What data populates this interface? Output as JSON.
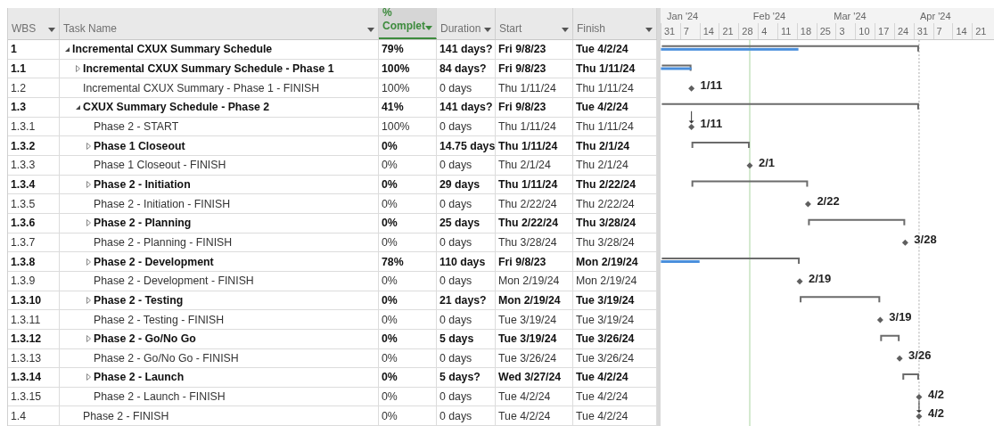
{
  "columns": [
    {
      "label": "WBS",
      "selected": false
    },
    {
      "label": "Task Name",
      "selected": false
    },
    {
      "label": "% Complet",
      "selected": true
    },
    {
      "label": "Duration",
      "selected": false
    },
    {
      "label": "Start",
      "selected": false
    },
    {
      "label": "Finish",
      "selected": false
    }
  ],
  "timescale": {
    "months": [
      "Jan '24",
      "Feb '24",
      "Mar '24",
      "Apr '24"
    ],
    "days": [
      "31",
      "7",
      "14",
      "21",
      "28",
      "4",
      "11",
      "18",
      "25",
      "3",
      "10",
      "17",
      "24",
      "31",
      "7",
      "14",
      "21"
    ]
  },
  "rows": [
    {
      "wbs": "1",
      "name": "Incremental CXUX Summary Schedule",
      "pct": "79%",
      "duration": "141 days?",
      "start": "Fri 9/8/23",
      "finish": "Tue 4/2/24",
      "kind": "summary",
      "expanded": true,
      "children": [
        {
          "wbs": "1.1",
          "name": "Incremental CXUX Summary Schedule - Phase 1",
          "pct": "100%",
          "duration": "84 days?",
          "start": "Fri 9/8/23",
          "finish": "Thu 1/11/24",
          "kind": "summary",
          "expanded": false
        },
        {
          "wbs": "1.2",
          "name": "Incremental CXUX Summary - Phase 1 - FINISH",
          "pct": "100%",
          "duration": "0 days",
          "start": "Thu 1/11/24",
          "finish": "Thu 1/11/24",
          "kind": "milestone",
          "gantt_label": "1/11",
          "linked": false
        },
        {
          "wbs": "1.3",
          "name": "CXUX Summary Schedule - Phase 2",
          "pct": "41%",
          "duration": "141 days?",
          "start": "Fri 9/8/23",
          "finish": "Tue 4/2/24",
          "kind": "summary",
          "expanded": true,
          "children": [
            {
              "wbs": "1.3.1",
              "name": "Phase 2 - START",
              "pct": "100%",
              "duration": "0 days",
              "start": "Thu 1/11/24",
              "finish": "Thu 1/11/24",
              "kind": "milestone",
              "gantt_label": "1/11",
              "linked": true
            },
            {
              "wbs": "1.3.2",
              "name": "Phase 1 Closeout",
              "pct": "0%",
              "duration": "14.75 days",
              "start": "Thu 1/11/24",
              "finish": "Thu 2/1/24",
              "kind": "summary",
              "expanded": false
            },
            {
              "wbs": "1.3.3",
              "name": "Phase 1 Closeout - FINISH",
              "pct": "0%",
              "duration": "0 days",
              "start": "Thu 2/1/24",
              "finish": "Thu 2/1/24",
              "kind": "milestone",
              "gantt_label": "2/1",
              "linked": false
            },
            {
              "wbs": "1.3.4",
              "name": "Phase 2 - Initiation",
              "pct": "0%",
              "duration": "29 days",
              "start": "Thu 1/11/24",
              "finish": "Thu 2/22/24",
              "kind": "summary",
              "expanded": false
            },
            {
              "wbs": "1.3.5",
              "name": "Phase 2 - Initiation - FINISH",
              "pct": "0%",
              "duration": "0 days",
              "start": "Thu 2/22/24",
              "finish": "Thu 2/22/24",
              "kind": "milestone",
              "gantt_label": "2/22",
              "linked": false
            },
            {
              "wbs": "1.3.6",
              "name": "Phase 2 - Planning",
              "pct": "0%",
              "duration": "25 days",
              "start": "Thu 2/22/24",
              "finish": "Thu 3/28/24",
              "kind": "summary",
              "expanded": false
            },
            {
              "wbs": "1.3.7",
              "name": "Phase 2 - Planning - FINISH",
              "pct": "0%",
              "duration": "0 days",
              "start": "Thu 3/28/24",
              "finish": "Thu 3/28/24",
              "kind": "milestone",
              "gantt_label": "3/28",
              "linked": false
            },
            {
              "wbs": "1.3.8",
              "name": "Phase 2 - Development",
              "pct": "78%",
              "duration": "110 days",
              "start": "Fri 9/8/23",
              "finish": "Mon 2/19/24",
              "kind": "summary",
              "expanded": false
            },
            {
              "wbs": "1.3.9",
              "name": "Phase 2 - Development - FINISH",
              "pct": "0%",
              "duration": "0 days",
              "start": "Mon 2/19/24",
              "finish": "Mon 2/19/24",
              "kind": "milestone",
              "gantt_label": "2/19",
              "linked": false
            },
            {
              "wbs": "1.3.10",
              "name": "Phase 2 - Testing",
              "pct": "0%",
              "duration": "21 days?",
              "start": "Mon 2/19/24",
              "finish": "Tue 3/19/24",
              "kind": "summary",
              "expanded": false
            },
            {
              "wbs": "1.3.11",
              "name": "Phase 2 - Testing  - FINISH",
              "pct": "0%",
              "duration": "0 days",
              "start": "Tue 3/19/24",
              "finish": "Tue 3/19/24",
              "kind": "milestone",
              "gantt_label": "3/19",
              "linked": false
            },
            {
              "wbs": "1.3.12",
              "name": "Phase 2 - Go/No Go",
              "pct": "0%",
              "duration": "5 days",
              "start": "Tue 3/19/24",
              "finish": "Tue 3/26/24",
              "kind": "summary",
              "expanded": false
            },
            {
              "wbs": "1.3.13",
              "name": "Phase 2 - Go/No Go - FINISH",
              "pct": "0%",
              "duration": "0 days",
              "start": "Tue 3/26/24",
              "finish": "Tue 3/26/24",
              "kind": "milestone",
              "gantt_label": "3/26",
              "linked": false
            },
            {
              "wbs": "1.3.14",
              "name": "Phase 2 - Launch",
              "pct": "0%",
              "duration": "5 days?",
              "start": "Wed 3/27/24",
              "finish": "Tue 4/2/24",
              "kind": "summary",
              "expanded": false
            },
            {
              "wbs": "1.3.15",
              "name": "Phase 2 - Launch - FINISH",
              "pct": "0%",
              "duration": "0 days",
              "start": "Tue 4/2/24",
              "finish": "Tue 4/2/24",
              "kind": "milestone",
              "gantt_label": "4/2",
              "linked": false
            }
          ]
        },
        {
          "wbs": "1.4",
          "name": "Phase 2 - FINISH",
          "pct": "0%",
          "duration": "0 days",
          "start": "Tue 4/2/24",
          "finish": "Tue 4/2/24",
          "kind": "milestone",
          "gantt_label": "4/2",
          "linked": true
        }
      ]
    }
  ]
}
